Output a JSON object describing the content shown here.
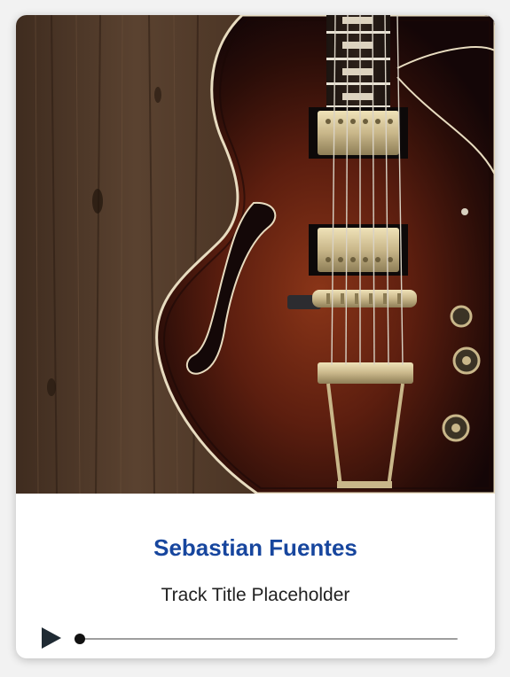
{
  "player": {
    "artist": "Sebastian Fuentes",
    "track_title": "Track Title Placeholder",
    "progress": 0.0,
    "accent_color": "#17469e",
    "play_icon": "play-icon",
    "artwork": "hollow-body electric guitar on dark wood background"
  }
}
